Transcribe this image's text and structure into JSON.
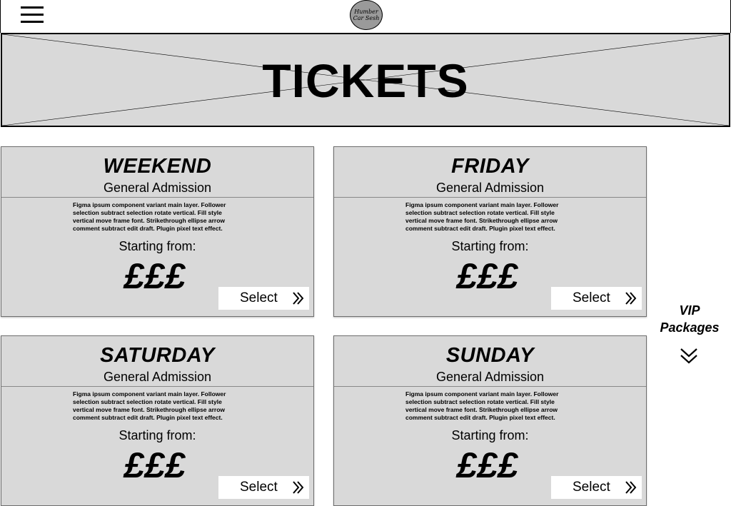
{
  "header": {
    "menu_icon": "hamburger-menu-icon",
    "logo_line1": "Humber",
    "logo_line2": "Car Sesh"
  },
  "hero": {
    "title": "TICKETS"
  },
  "tickets": [
    {
      "day": "WEEKEND",
      "admission": "General Admission",
      "description": "Figma ipsum component variant main layer. Follower selection subtract selection rotate vertical. Fill style vertical move frame font. Strikethrough ellipse arrow comment subtract edit draft. Plugin pixel text effect.",
      "starting_label": "Starting from:",
      "price": "£££",
      "select_label": "Select"
    },
    {
      "day": "FRIDAY",
      "admission": "General Admission",
      "description": "Figma ipsum component variant main layer. Follower selection subtract selection rotate vertical. Fill style vertical move frame font. Strikethrough ellipse arrow comment subtract edit draft. Plugin pixel text effect.",
      "starting_label": "Starting from:",
      "price": "£££",
      "select_label": "Select"
    },
    {
      "day": "SATURDAY",
      "admission": "General Admission",
      "description": "Figma ipsum component variant main layer. Follower selection subtract selection rotate vertical. Fill style vertical move frame font. Strikethrough ellipse arrow comment subtract edit draft. Plugin pixel text effect.",
      "starting_label": "Starting from:",
      "price": "£££",
      "select_label": "Select"
    },
    {
      "day": "SUNDAY",
      "admission": "General Admission",
      "description": "Figma ipsum component variant main layer. Follower selection subtract selection rotate vertical. Fill style vertical move frame font. Strikethrough ellipse arrow comment subtract edit draft. Plugin pixel text effect.",
      "starting_label": "Starting from:",
      "price": "£££",
      "select_label": "Select"
    }
  ],
  "vip": {
    "line1": "VIP",
    "line2": "Packages",
    "arrow_icon": "double-chevron-down-icon"
  },
  "colors": {
    "placeholder_fill": "#d9d9d9",
    "logo_fill": "#9a9a9a",
    "border": "#000000"
  }
}
